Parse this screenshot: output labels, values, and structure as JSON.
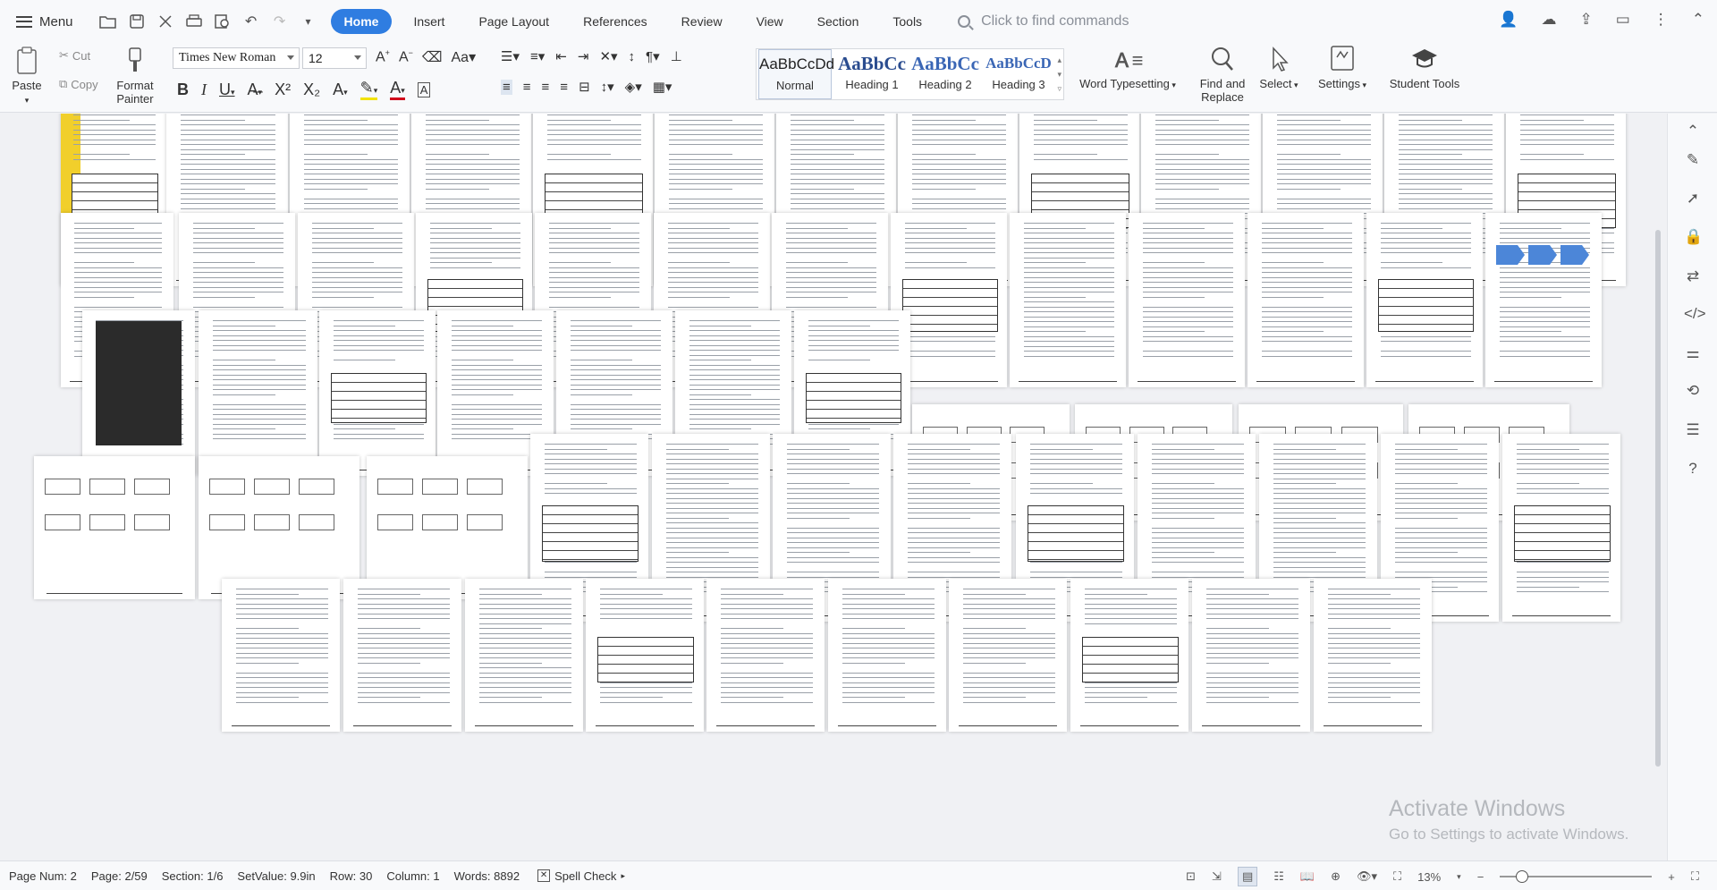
{
  "topbar": {
    "menu_label": "Menu",
    "tabs": [
      {
        "label": "Home",
        "active": true
      },
      {
        "label": "Insert"
      },
      {
        "label": "Page Layout"
      },
      {
        "label": "References"
      },
      {
        "label": "Review"
      },
      {
        "label": "View"
      },
      {
        "label": "Section"
      },
      {
        "label": "Tools"
      }
    ],
    "command_search_placeholder": "Click to find commands"
  },
  "ribbon": {
    "paste_label": "Paste",
    "cut_label": "Cut",
    "copy_label": "Copy",
    "format_painter_label": "Format Painter",
    "font_name": "Times New Roman",
    "font_size": "12",
    "styles": [
      {
        "preview": "AaBbCcDd",
        "label": "Normal"
      },
      {
        "preview": "AaBbCc",
        "label": "Heading 1"
      },
      {
        "preview": "AaBbCc",
        "label": "Heading 2"
      },
      {
        "preview": "AaBbCcD",
        "label": "Heading 3"
      }
    ],
    "word_typesetting_label": "Word Typesetting",
    "find_replace_label": "Find and Replace",
    "select_label": "Select",
    "settings_label": "Settings",
    "student_tools_label": "Student Tools"
  },
  "status": {
    "page_num": "Page Num: 2",
    "page": "Page: 2/59",
    "section": "Section: 1/6",
    "set_value": "SetValue: 9.9in",
    "row": "Row: 30",
    "column": "Column: 1",
    "words": "Words: 8892",
    "spell_check": "Spell Check",
    "zoom": "13%"
  },
  "watermark": {
    "title": "Activate Windows",
    "subtitle": "Go to Settings to activate Windows."
  },
  "colors": {
    "accent": "#2f7de1",
    "cover_yellow": "#f1cf2b",
    "diagram_blue": "#4c86d8"
  }
}
